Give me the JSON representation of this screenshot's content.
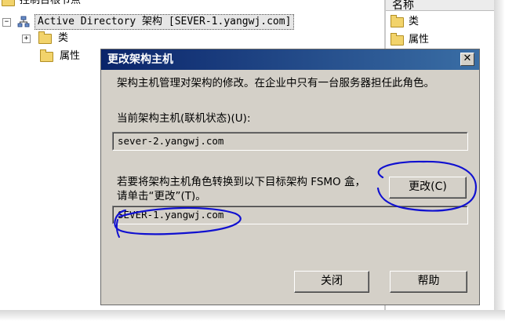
{
  "tree": {
    "root_label": "控制台根节点",
    "ad_node_label": "Active Directory 架构 [SEVER-1.yangwj.com]",
    "expander_symbol": "−",
    "children": [
      {
        "label": "类",
        "expander_symbol": "+"
      },
      {
        "label": "属性"
      }
    ]
  },
  "right_pane": {
    "column_header": "名称",
    "items": [
      {
        "label": "类"
      },
      {
        "label": "属性"
      }
    ]
  },
  "dialog": {
    "title": "更改架构主机",
    "close_symbol": "✕",
    "description": "架构主机管理对架构的修改。在企业中只有一台服务器担任此角色。",
    "current_label": "当前架构主机(联机状态)(U):",
    "current_value": "sever-2.yangwj.com",
    "transfer_text": "若要将架构主机角色转换到以下目标架构 FSMO 盒，请单击“更改”(T)。",
    "target_value": "SEVER-1.yangwj.com",
    "change_button": "更改(C)",
    "close_button": "关闭",
    "help_button": "帮助"
  },
  "colors": {
    "titlebar_start": "#0a246a",
    "titlebar_end": "#3a6ea5",
    "dialog_face": "#d4d0c8",
    "annotation_ink": "#1010d0",
    "folder": "#f2d36b"
  },
  "icons": {
    "folder": "folder-icon",
    "ad_schema": "ad-schema-icon",
    "close": "close-icon"
  }
}
